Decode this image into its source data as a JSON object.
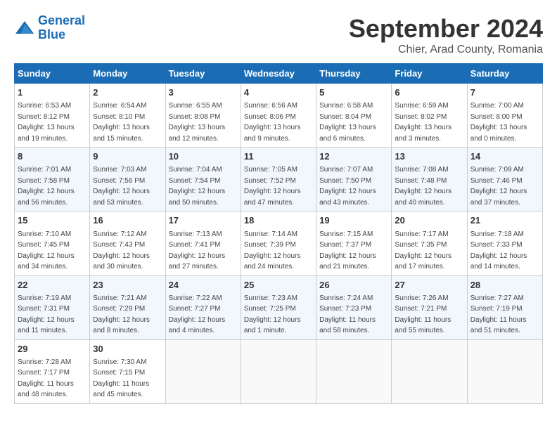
{
  "header": {
    "logo_line1": "General",
    "logo_line2": "Blue",
    "month": "September 2024",
    "location": "Chier, Arad County, Romania"
  },
  "weekdays": [
    "Sunday",
    "Monday",
    "Tuesday",
    "Wednesday",
    "Thursday",
    "Friday",
    "Saturday"
  ],
  "weeks": [
    [
      {
        "day": 1,
        "info": "Sunrise: 6:53 AM\nSunset: 8:12 PM\nDaylight: 13 hours\nand 19 minutes."
      },
      {
        "day": 2,
        "info": "Sunrise: 6:54 AM\nSunset: 8:10 PM\nDaylight: 13 hours\nand 15 minutes."
      },
      {
        "day": 3,
        "info": "Sunrise: 6:55 AM\nSunset: 8:08 PM\nDaylight: 13 hours\nand 12 minutes."
      },
      {
        "day": 4,
        "info": "Sunrise: 6:56 AM\nSunset: 8:06 PM\nDaylight: 13 hours\nand 9 minutes."
      },
      {
        "day": 5,
        "info": "Sunrise: 6:58 AM\nSunset: 8:04 PM\nDaylight: 13 hours\nand 6 minutes."
      },
      {
        "day": 6,
        "info": "Sunrise: 6:59 AM\nSunset: 8:02 PM\nDaylight: 13 hours\nand 3 minutes."
      },
      {
        "day": 7,
        "info": "Sunrise: 7:00 AM\nSunset: 8:00 PM\nDaylight: 13 hours\nand 0 minutes."
      }
    ],
    [
      {
        "day": 8,
        "info": "Sunrise: 7:01 AM\nSunset: 7:58 PM\nDaylight: 12 hours\nand 56 minutes."
      },
      {
        "day": 9,
        "info": "Sunrise: 7:03 AM\nSunset: 7:56 PM\nDaylight: 12 hours\nand 53 minutes."
      },
      {
        "day": 10,
        "info": "Sunrise: 7:04 AM\nSunset: 7:54 PM\nDaylight: 12 hours\nand 50 minutes."
      },
      {
        "day": 11,
        "info": "Sunrise: 7:05 AM\nSunset: 7:52 PM\nDaylight: 12 hours\nand 47 minutes."
      },
      {
        "day": 12,
        "info": "Sunrise: 7:07 AM\nSunset: 7:50 PM\nDaylight: 12 hours\nand 43 minutes."
      },
      {
        "day": 13,
        "info": "Sunrise: 7:08 AM\nSunset: 7:48 PM\nDaylight: 12 hours\nand 40 minutes."
      },
      {
        "day": 14,
        "info": "Sunrise: 7:09 AM\nSunset: 7:46 PM\nDaylight: 12 hours\nand 37 minutes."
      }
    ],
    [
      {
        "day": 15,
        "info": "Sunrise: 7:10 AM\nSunset: 7:45 PM\nDaylight: 12 hours\nand 34 minutes."
      },
      {
        "day": 16,
        "info": "Sunrise: 7:12 AM\nSunset: 7:43 PM\nDaylight: 12 hours\nand 30 minutes."
      },
      {
        "day": 17,
        "info": "Sunrise: 7:13 AM\nSunset: 7:41 PM\nDaylight: 12 hours\nand 27 minutes."
      },
      {
        "day": 18,
        "info": "Sunrise: 7:14 AM\nSunset: 7:39 PM\nDaylight: 12 hours\nand 24 minutes."
      },
      {
        "day": 19,
        "info": "Sunrise: 7:15 AM\nSunset: 7:37 PM\nDaylight: 12 hours\nand 21 minutes."
      },
      {
        "day": 20,
        "info": "Sunrise: 7:17 AM\nSunset: 7:35 PM\nDaylight: 12 hours\nand 17 minutes."
      },
      {
        "day": 21,
        "info": "Sunrise: 7:18 AM\nSunset: 7:33 PM\nDaylight: 12 hours\nand 14 minutes."
      }
    ],
    [
      {
        "day": 22,
        "info": "Sunrise: 7:19 AM\nSunset: 7:31 PM\nDaylight: 12 hours\nand 11 minutes."
      },
      {
        "day": 23,
        "info": "Sunrise: 7:21 AM\nSunset: 7:29 PM\nDaylight: 12 hours\nand 8 minutes."
      },
      {
        "day": 24,
        "info": "Sunrise: 7:22 AM\nSunset: 7:27 PM\nDaylight: 12 hours\nand 4 minutes."
      },
      {
        "day": 25,
        "info": "Sunrise: 7:23 AM\nSunset: 7:25 PM\nDaylight: 12 hours\nand 1 minute."
      },
      {
        "day": 26,
        "info": "Sunrise: 7:24 AM\nSunset: 7:23 PM\nDaylight: 11 hours\nand 58 minutes."
      },
      {
        "day": 27,
        "info": "Sunrise: 7:26 AM\nSunset: 7:21 PM\nDaylight: 11 hours\nand 55 minutes."
      },
      {
        "day": 28,
        "info": "Sunrise: 7:27 AM\nSunset: 7:19 PM\nDaylight: 11 hours\nand 51 minutes."
      }
    ],
    [
      {
        "day": 29,
        "info": "Sunrise: 7:28 AM\nSunset: 7:17 PM\nDaylight: 11 hours\nand 48 minutes."
      },
      {
        "day": 30,
        "info": "Sunrise: 7:30 AM\nSunset: 7:15 PM\nDaylight: 11 hours\nand 45 minutes."
      },
      null,
      null,
      null,
      null,
      null
    ]
  ]
}
